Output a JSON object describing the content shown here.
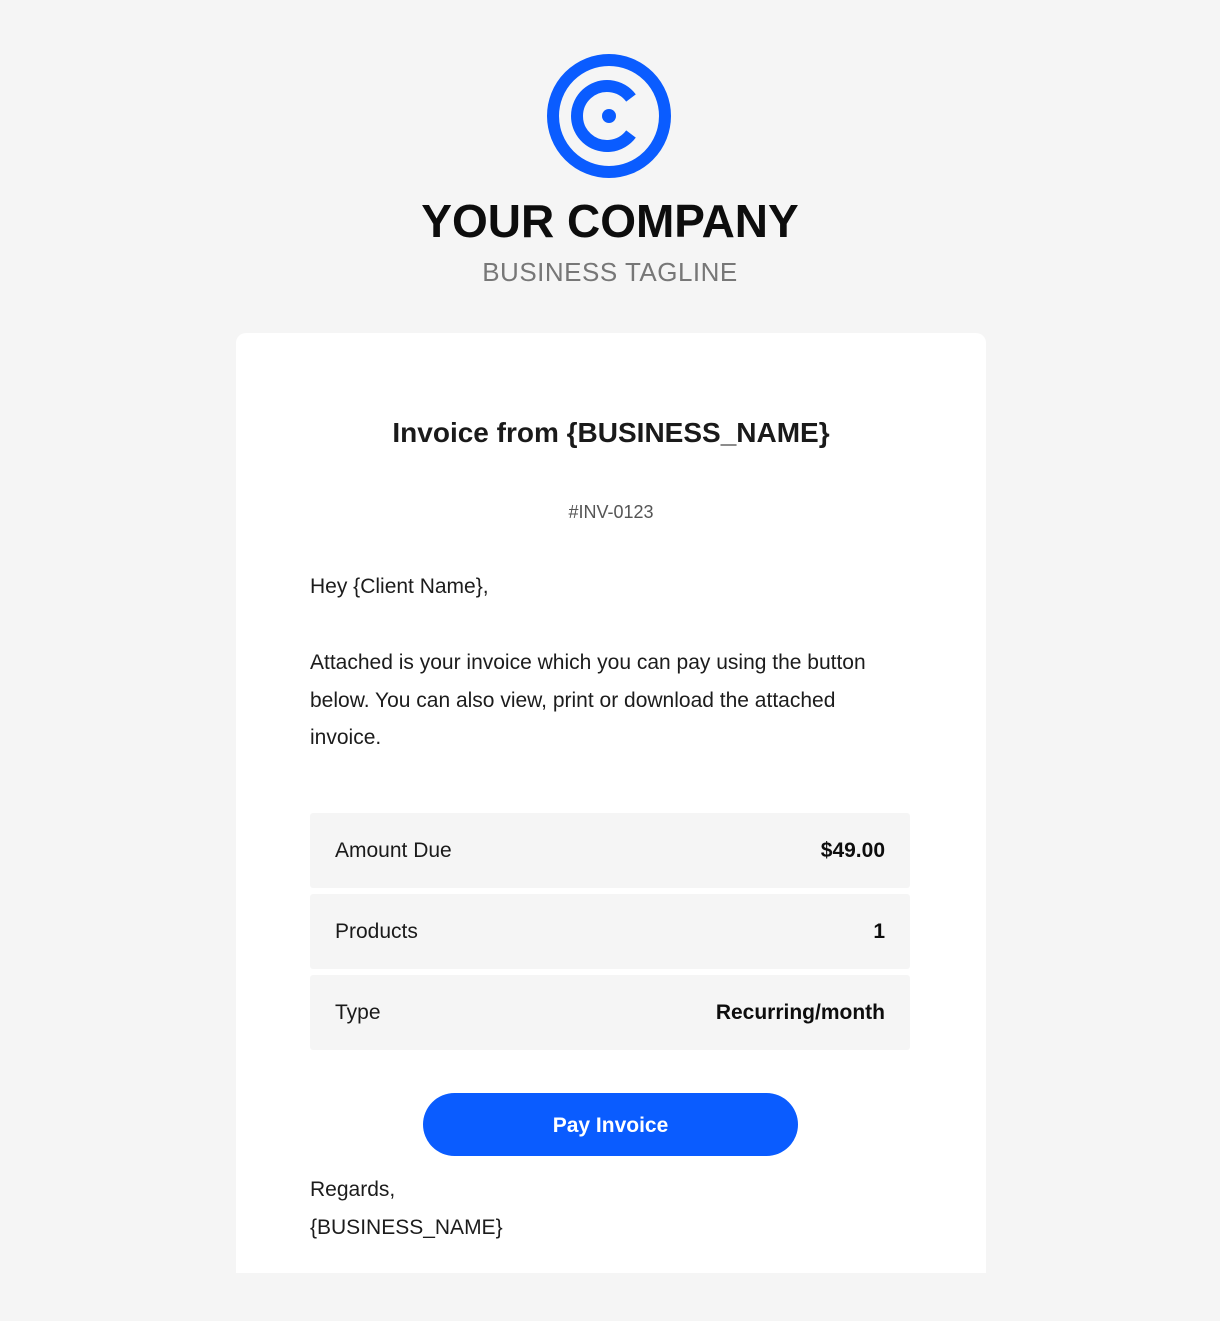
{
  "header": {
    "logo_icon": "company-c-logo",
    "company_name": "YOUR COMPANY",
    "tagline": "BUSINESS TAGLINE"
  },
  "invoice": {
    "title": "Invoice from {BUSINESS_NAME}",
    "number": "#INV-0123",
    "greeting": "Hey {Client Name},",
    "message": "Attached is your invoice which you can pay using the button below. You can also view, print or download the attached invoice.",
    "details": [
      {
        "label": "Amount Due",
        "value": "$49.00"
      },
      {
        "label": "Products",
        "value": "1"
      },
      {
        "label": "Type",
        "value": "Recurring/month"
      }
    ],
    "pay_button_label": "Pay Invoice",
    "regards": "Regards,",
    "signature": "{BUSINESS_NAME}"
  },
  "colors": {
    "brand": "#0a5cff",
    "background": "#f5f5f5",
    "card": "#ffffff"
  }
}
